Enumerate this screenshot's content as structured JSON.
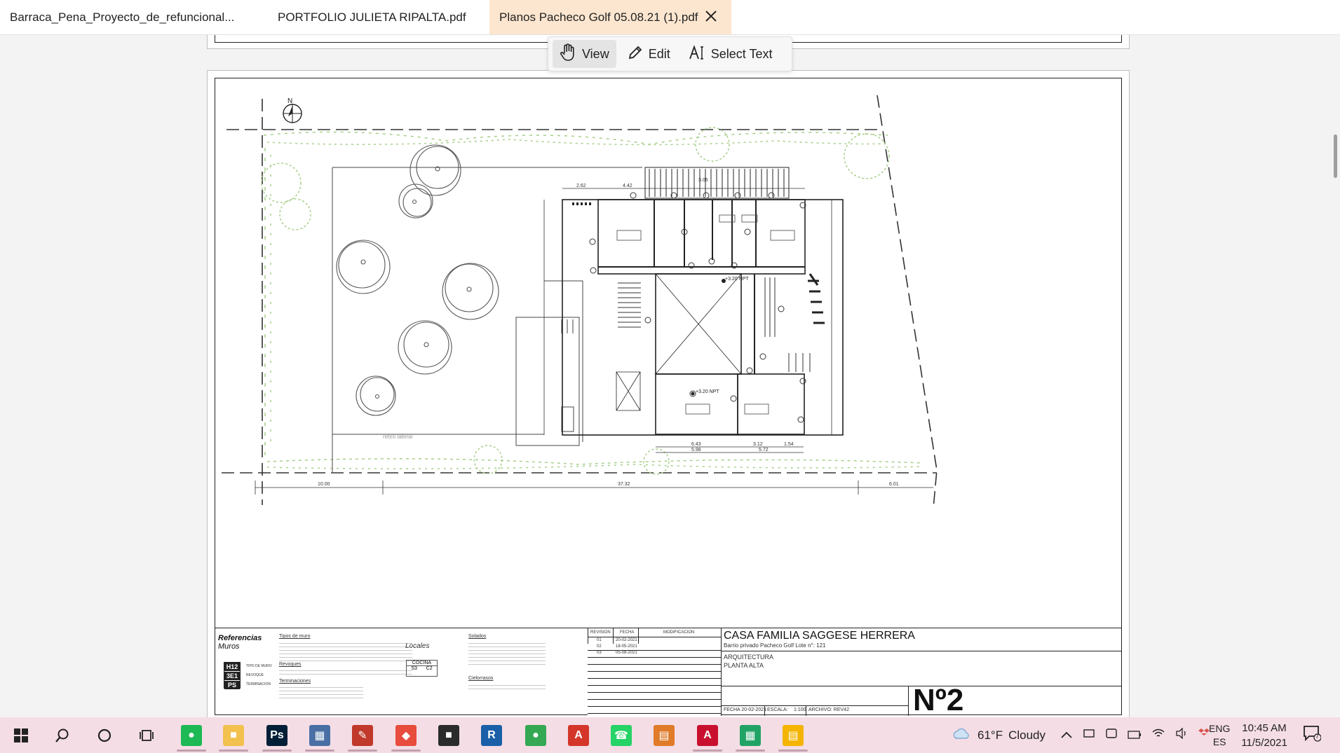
{
  "tabs": [
    {
      "label": "Barraca_Pena_Proyecto_de_refuncional...",
      "active": false
    },
    {
      "label": "PORTFOLIO JULIETA RIPALTA.pdf",
      "active": false
    },
    {
      "label": "Planos Pacheco Golf 05.08.21 (1).pdf",
      "active": true
    }
  ],
  "modes": [
    {
      "label": "View",
      "icon": "hand-icon",
      "active": true
    },
    {
      "label": "Edit",
      "icon": "pencil-icon",
      "active": false
    },
    {
      "label": "Select Text",
      "icon": "text-cursor-icon",
      "active": false
    }
  ],
  "plan": {
    "north_label": "N",
    "labels": {
      "retiro_lateral": "retiro lateral",
      "dim_bottom_left": "10.00",
      "dim_bottom_mid": "37.32",
      "dim_bottom_right": "6.01",
      "level_top": "+3.20 NPT",
      "level_bottom": "+3.20 NPT",
      "dim_a": "6.43",
      "dim_b": "3.12",
      "dim_c": "1.54",
      "dim_d": "5.98",
      "dim_e": "5.72",
      "dim_f": "2.62",
      "dim_g": "4.42",
      "dim_h": "3.05"
    }
  },
  "title_block": {
    "referencias": "Referencias",
    "muros": "Muros",
    "tipos_muro": "Tipos de muro",
    "revoques": "Revoques",
    "terminaciones": "Terminaciones",
    "locales": "Locales",
    "solados": "Solados",
    "cielorrasos": "Cielorrasos",
    "legend_codes": [
      "H12",
      "3E1",
      "PS"
    ],
    "legend_notes": [
      "TIPO DE MURO",
      "REVOQUE",
      "TERMINACION"
    ],
    "local_code": "COCINA",
    "local_sub": [
      "S3",
      "C2"
    ],
    "rev_headers": [
      "REVISION",
      "FECHA",
      "MODIFICACION"
    ],
    "revisions": [
      {
        "num": "01",
        "date": "20-02-2021"
      },
      {
        "num": "02",
        "date": "18-05-2021"
      },
      {
        "num": "03",
        "date": "05-08-2021"
      }
    ],
    "project": "CASA FAMILIA SAGGESE HERRERA",
    "location": "Barrio privado Pacheco Golf Lote n°: 121",
    "discipline": "ARQUITECTURA",
    "plan_name": "PLANTA ALTA",
    "fecha": "FECHA 20-02-2021",
    "escala_label": "ESCALA:",
    "escala": "1:100",
    "archivo": "ARCHIVO: REV42",
    "sheet": "Nº2"
  },
  "taskbar": {
    "weather_temp": "61°F",
    "weather_desc": "Cloudy",
    "lang_top": "ENG",
    "lang_bottom": "ES",
    "time": "10:45 AM",
    "date": "11/5/2021",
    "notif_count": "7",
    "apps": [
      {
        "name": "spotify-icon",
        "color": "#1db954"
      },
      {
        "name": "file-explorer-icon",
        "color": "#f2c14e"
      },
      {
        "name": "photoshop-icon",
        "color": "#001e36"
      },
      {
        "name": "calculator-icon",
        "color": "#4a6fa5"
      },
      {
        "name": "pencil-app-icon",
        "color": "#c0392b"
      },
      {
        "name": "sketchup-icon",
        "color": "#e74c3c"
      },
      {
        "name": "sticky-notes-icon",
        "color": "#2b2b2b"
      },
      {
        "name": "revit-icon",
        "color": "#1a5fa8"
      },
      {
        "name": "chrome-icon",
        "color": "#34a853"
      },
      {
        "name": "acrobat-icon",
        "color": "#d4362a"
      },
      {
        "name": "whatsapp-icon",
        "color": "#25d366"
      },
      {
        "name": "document-app-icon",
        "color": "#e07b2a"
      },
      {
        "name": "autocad-icon",
        "color": "#c8102e"
      },
      {
        "name": "sheets-icon",
        "color": "#21a366"
      },
      {
        "name": "slides-icon",
        "color": "#f4b400"
      }
    ]
  }
}
